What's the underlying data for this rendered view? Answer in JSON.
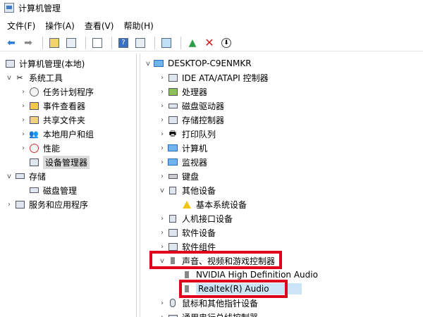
{
  "window": {
    "title": "计算机管理"
  },
  "menu": [
    "文件(F)",
    "操作(A)",
    "查看(V)",
    "帮助(H)"
  ],
  "tree": {
    "root": "计算机管理(本地)",
    "items": [
      {
        "label": "系统工具",
        "level": 1,
        "caret": "v",
        "icon": "tools-icon"
      },
      {
        "label": "任务计划程序",
        "level": 2,
        "caret": ">",
        "icon": "clock-icon"
      },
      {
        "label": "事件查看器",
        "level": 2,
        "caret": ">",
        "icon": "event-viewer-icon"
      },
      {
        "label": "共享文件夹",
        "level": 2,
        "caret": ">",
        "icon": "shared-folder-icon"
      },
      {
        "label": "本地用户和组",
        "level": 2,
        "caret": ">",
        "icon": "users-icon"
      },
      {
        "label": "性能",
        "level": 2,
        "caret": ">",
        "icon": "performance-icon"
      },
      {
        "label": "设备管理器",
        "level": 2,
        "caret": "",
        "icon": "device-manager-icon",
        "selected": true
      },
      {
        "label": "存储",
        "level": 1,
        "caret": "v",
        "icon": "storage-icon"
      },
      {
        "label": "磁盘管理",
        "level": 2,
        "caret": "",
        "icon": "disk-icon"
      },
      {
        "label": "服务和应用程序",
        "level": 1,
        "caret": ">",
        "icon": "services-icon"
      }
    ]
  },
  "devices": {
    "computer": "DESKTOP-C9ENMKR",
    "items": [
      {
        "label": "IDE ATA/ATAPI 控制器",
        "level": 1,
        "caret": ">",
        "icon": "ide-icon"
      },
      {
        "label": "处理器",
        "level": 1,
        "caret": ">",
        "icon": "processor-icon"
      },
      {
        "label": "磁盘驱动器",
        "level": 1,
        "caret": ">",
        "icon": "disk-drive-icon"
      },
      {
        "label": "存储控制器",
        "level": 1,
        "caret": ">",
        "icon": "storage-controller-icon"
      },
      {
        "label": "打印队列",
        "level": 1,
        "caret": ">",
        "icon": "printer-icon"
      },
      {
        "label": "计算机",
        "level": 1,
        "caret": ">",
        "icon": "computer-icon"
      },
      {
        "label": "监视器",
        "level": 1,
        "caret": ">",
        "icon": "monitor-icon"
      },
      {
        "label": "键盘",
        "level": 1,
        "caret": ">",
        "icon": "keyboard-icon"
      },
      {
        "label": "其他设备",
        "level": 1,
        "caret": "v",
        "icon": "other-device-icon"
      },
      {
        "label": "基本系统设备",
        "level": 2,
        "caret": "",
        "icon": "warning-device-icon"
      },
      {
        "label": "人机接口设备",
        "level": 1,
        "caret": ">",
        "icon": "hid-icon"
      },
      {
        "label": "软件设备",
        "level": 1,
        "caret": ">",
        "icon": "software-device-icon"
      },
      {
        "label": "软件组件",
        "level": 1,
        "caret": ">",
        "icon": "software-component-icon"
      },
      {
        "label": "声音、视频和游戏控制器",
        "level": 1,
        "caret": "v",
        "icon": "speaker-icon"
      },
      {
        "label": "NVIDIA High Definition Audio",
        "level": 2,
        "caret": "",
        "icon": "audio-device-icon"
      },
      {
        "label": "Realtek(R) Audio",
        "level": 2,
        "caret": "",
        "icon": "audio-device-icon",
        "highlighted": true
      },
      {
        "label": "鼠标和其他指针设备",
        "level": 1,
        "caret": ">",
        "icon": "mouse-icon"
      },
      {
        "label": "通用串行总线控制器",
        "level": 1,
        "caret": ">",
        "icon": "usb-icon"
      }
    ]
  }
}
